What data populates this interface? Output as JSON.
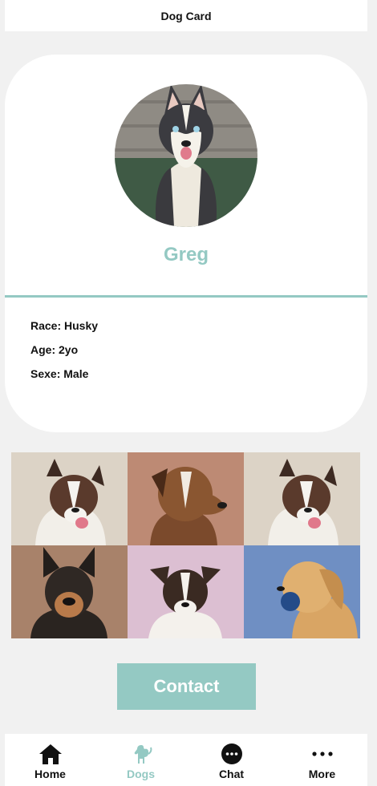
{
  "header": {
    "title": "Dog Card"
  },
  "profile": {
    "name": "Greg",
    "details": [
      "Race: Husky",
      "Age: 2yo",
      "Sexe: Male"
    ]
  },
  "gallery": {
    "tiles": [
      {
        "icon": "dog-photo-aussie",
        "bg": "#dcd3c6"
      },
      {
        "icon": "dog-photo-boxer",
        "bg": "#bd8a74"
      },
      {
        "icon": "dog-photo-aussie",
        "bg": "#dcd3c6"
      },
      {
        "icon": "dog-photo-shepherd",
        "bg": "#a8826a"
      },
      {
        "icon": "dog-photo-terrier",
        "bg": "#dcbfd2"
      },
      {
        "icon": "dog-photo-retriever",
        "bg": "#6f8fc3"
      }
    ]
  },
  "contact": {
    "label": "Contact"
  },
  "tabs": [
    {
      "label": "Home",
      "icon": "home-icon",
      "active": false
    },
    {
      "label": "Dogs",
      "icon": "dog-icon",
      "active": true
    },
    {
      "label": "Chat",
      "icon": "chat-icon",
      "active": false
    },
    {
      "label": "More",
      "icon": "more-icon",
      "active": false
    }
  ],
  "colors": {
    "accent": "#94c9c3",
    "background": "#f1f1f1",
    "card": "#ffffff",
    "text": "#111111"
  }
}
